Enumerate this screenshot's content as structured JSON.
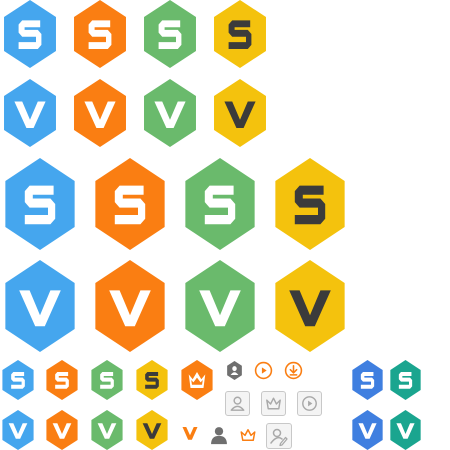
{
  "colors": {
    "blue": "#45a6ee",
    "orange": "#fa7e12",
    "green": "#6aba6c",
    "yellow": "#f4c20d",
    "dark_blue": "#3f7fe0",
    "teal": "#1aa58f",
    "white": "#ffffff",
    "dark_glyph": "#3b3b3b",
    "gray": "#6f6f6f",
    "light_gray": "#a9a9a9",
    "box_border": "#c8c8c8",
    "box_background": "#f4f4f4"
  },
  "icons": {
    "s_medium_row": [
      "s-hex-blue-icon",
      "s-hex-orange-icon",
      "s-hex-green-icon",
      "s-hex-yellow-icon"
    ],
    "v_medium_row": [
      "v-hex-blue-icon",
      "v-hex-orange-icon",
      "v-hex-green-icon",
      "v-hex-yellow-icon"
    ],
    "s_large_row": [
      "s-hex-blue-icon",
      "s-hex-orange-icon",
      "s-hex-green-icon",
      "s-hex-yellow-icon"
    ],
    "v_large_row": [
      "v-hex-blue-icon",
      "v-hex-orange-icon",
      "v-hex-green-icon",
      "v-hex-yellow-icon"
    ],
    "small_s_row": [
      "s-hex-blue-icon",
      "s-hex-orange-icon",
      "s-hex-green-icon",
      "s-hex-yellow-icon",
      "crown-hex-orange-icon"
    ],
    "small_v_row": [
      "v-hex-blue-icon",
      "v-hex-orange-icon",
      "v-hex-green-icon",
      "v-hex-yellow-icon",
      "v-orange-icon",
      "user-gray-icon",
      "crown-outline-orange-icon",
      "user-edit-box-icon"
    ],
    "misc_top": [
      "user-hex-gray-icon",
      "play-circle-orange-icon",
      "download-circle-orange-icon"
    ],
    "misc_boxed": [
      "user-box-icon",
      "crown-box-icon",
      "play-box-icon"
    ],
    "alt_palette": [
      "s-hex-dark-blue-icon",
      "s-hex-teal-icon",
      "v-hex-dark-blue-icon",
      "v-hex-teal-icon"
    ]
  }
}
